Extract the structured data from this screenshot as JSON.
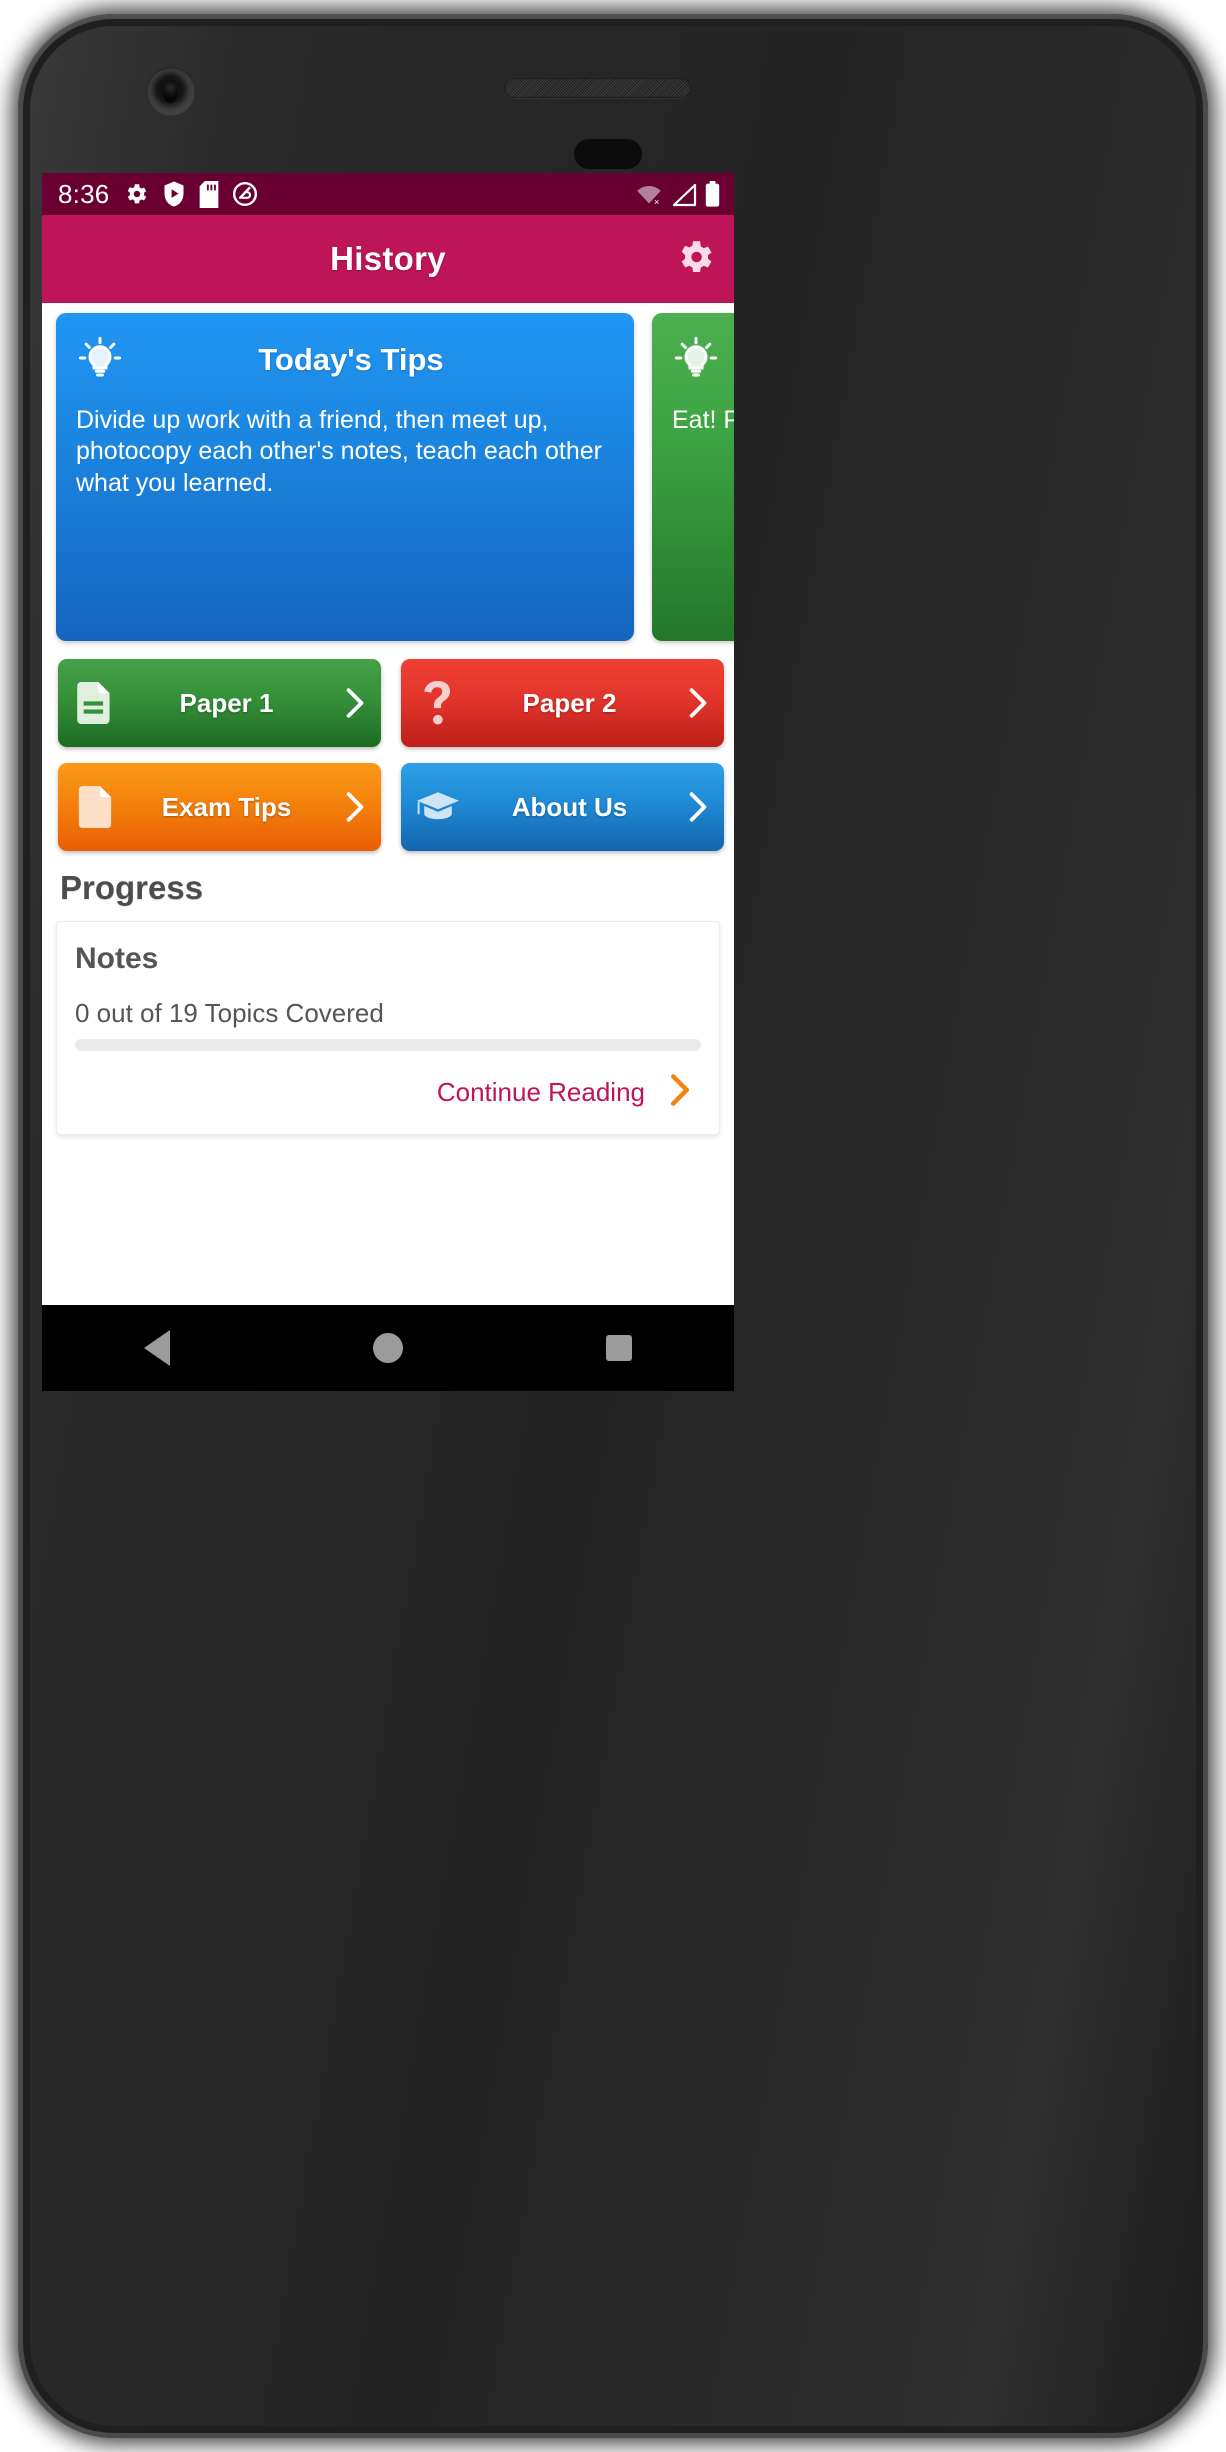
{
  "status_bar": {
    "time": "8:36",
    "left_icons": [
      "gear-icon",
      "shield-play-icon",
      "sd-card-icon",
      "do-not-disturb-icon"
    ],
    "right_icons": [
      "wifi-off-icon",
      "cellular-signal-icon",
      "battery-full-icon"
    ],
    "background_color": "#6A0032"
  },
  "app_bar": {
    "title": "History",
    "settings_icon": "gear-icon",
    "background_color": "#BE1558"
  },
  "tips": {
    "cards": [
      {
        "icon": "lightbulb-icon",
        "title": "Today's Tips",
        "body": "Divide up work with a friend, then meet up, photocopy each other's notes, teach each other what you learned.",
        "color": "#1E88E5"
      },
      {
        "icon": "lightbulb-icon",
        "title": "",
        "body": "Eat! Pick minor chocolate",
        "color": "#3DA343"
      }
    ]
  },
  "nav_buttons": [
    {
      "label": "Paper 1",
      "icon": "document-icon",
      "chevron": "chevron-right-icon",
      "color": "#35903A"
    },
    {
      "label": "Paper 2",
      "icon": "question-mark-icon",
      "chevron": "chevron-right-icon",
      "color": "#E2352C"
    },
    {
      "label": "Exam Tips",
      "icon": "page-icon",
      "chevron": "chevron-right-icon",
      "color": "#F4820D"
    },
    {
      "label": "About Us",
      "icon": "graduation-cap-icon",
      "chevron": "chevron-right-icon",
      "color": "#1F8AD6"
    }
  ],
  "progress": {
    "heading": "Progress",
    "card_title": "Notes",
    "count_text": "0 out of 19 Topics Covered",
    "percent": 0,
    "continue_label": "Continue Reading",
    "continue_chevron": "chevron-right-icon",
    "link_color": "#BE1558",
    "chevron_color": "#F4820D"
  },
  "system_nav": {
    "back": "back-triangle-icon",
    "home": "home-circle-icon",
    "recents": "recents-square-icon"
  }
}
